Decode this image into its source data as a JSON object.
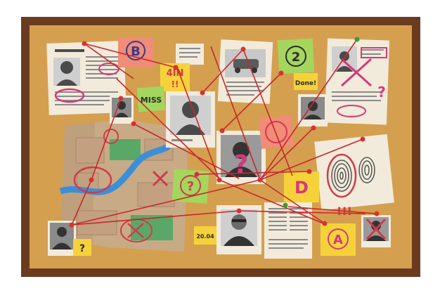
{
  "notes": {
    "sticky_b": "B",
    "sticky_2": "2",
    "sticky_4in": "4IN",
    "sticky_miss": "MISS",
    "sticky_done": "Done!",
    "sticky_q_mid": "?",
    "sticky_q_left": "?",
    "sticky_q_bottom": "?",
    "sticky_d": "D",
    "sticky_a": "A",
    "sticky_date": "20.04",
    "exclaim_top": "!!",
    "exclaim_bottom": "!!!",
    "question_mark": "?"
  },
  "colors": {
    "frame": "#6b3b1f",
    "cork": "#d4a04f",
    "string": "#c8282d",
    "marker": "#d23a7a",
    "pin_red": "#d63232",
    "pin_green": "#3c9a3c",
    "sticky_pink": "#f08c78",
    "sticky_green": "#a4d65e",
    "sticky_yellow": "#f6d23a",
    "paper": "#f2ebdc"
  }
}
